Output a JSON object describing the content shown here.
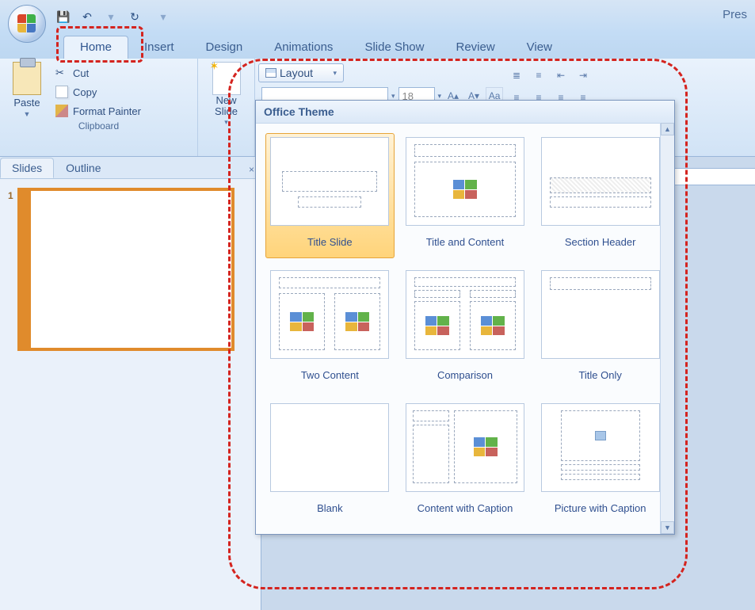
{
  "titlebar": {
    "doc_title": "Pres"
  },
  "qat": {
    "save": "save",
    "undo": "undo",
    "redo": "redo"
  },
  "tabs": {
    "home": "Home",
    "insert": "Insert",
    "design": "Design",
    "animations": "Animations",
    "slideshow": "Slide Show",
    "review": "Review",
    "view": "View"
  },
  "ribbon": {
    "paste_label": "Paste",
    "cut_label": "Cut",
    "copy_label": "Copy",
    "format_painter_label": "Format Painter",
    "clipboard_group": "Clipboard",
    "newslide_label": "New Slide",
    "layout_label": "Layout",
    "font_size_value": "18"
  },
  "slidepanel": {
    "slides_tab": "Slides",
    "outline_tab": "Outline",
    "thumb_number": "1"
  },
  "gallery": {
    "header": "Office Theme",
    "items": [
      {
        "label": "Title Slide"
      },
      {
        "label": "Title and Content"
      },
      {
        "label": "Section Header"
      },
      {
        "label": "Two Content"
      },
      {
        "label": "Comparison"
      },
      {
        "label": "Title Only"
      },
      {
        "label": "Blank"
      },
      {
        "label": "Content with Caption"
      },
      {
        "label": "Picture with Caption"
      }
    ]
  }
}
